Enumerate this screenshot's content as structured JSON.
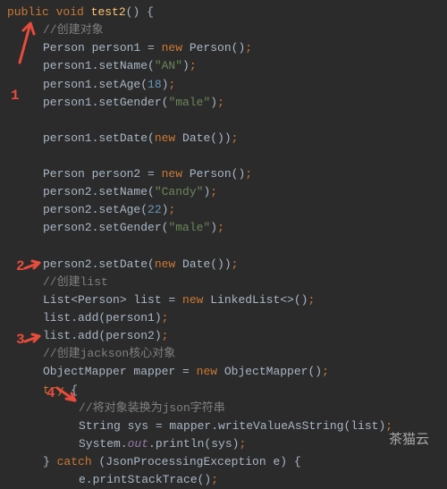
{
  "code": {
    "l1_kw1": "public",
    "l1_kw2": "void",
    "l1_method": "test2",
    "l1_rest": "() {",
    "l2_comment": "//创建对象",
    "l3_a": "Person person1 = ",
    "l3_kw": "new",
    "l3_b": " Person()",
    "l3_semi": ";",
    "l4_a": "person1.setName(",
    "l4_str": "\"AN\"",
    "l4_b": ")",
    "l4_semi": ";",
    "l5_a": "person1.setAge(",
    "l5_num": "18",
    "l5_b": ")",
    "l5_semi": ";",
    "l6_a": "person1.setGender(",
    "l6_str": "\"male\"",
    "l6_b": ")",
    "l6_semi": ";",
    "l7_a": "person1.setDate(",
    "l7_kw": "new",
    "l7_b": " Date())",
    "l7_semi": ";",
    "l8_a": "Person person2 = ",
    "l8_kw": "new",
    "l8_b": " Person()",
    "l8_semi": ";",
    "l9_a": "person2.setName(",
    "l9_str": "\"Candy\"",
    "l9_b": ")",
    "l9_semi": ";",
    "l10_a": "person2.setAge(",
    "l10_num": "22",
    "l10_b": ")",
    "l10_semi": ";",
    "l11_a": "person2.setGender(",
    "l11_str": "\"male\"",
    "l11_b": ")",
    "l11_semi": ";",
    "l12_a": "person2.setDate(",
    "l12_kw": "new",
    "l12_b": " Date())",
    "l12_semi": ";",
    "l13_comment": "//创建list",
    "l14_a": "List<Person> list = ",
    "l14_kw": "new",
    "l14_b": " LinkedList<>()",
    "l14_semi": ";",
    "l15_a": "list.add(person1)",
    "l15_semi": ";",
    "l16_a": "list.add(person2)",
    "l16_semi": ";",
    "l17_comment": "//创建jackson核心对象",
    "l18_a": "ObjectMapper mapper = ",
    "l18_kw": "new",
    "l18_b": " ObjectMapper()",
    "l18_semi": ";",
    "l19_kw": "try",
    "l19_b": " {",
    "l20_comment": "//将对象装换为json字符串",
    "l21_a": "String sys = mapper.writeValueAsString(list)",
    "l21_semi": ";",
    "l22_a": "System.",
    "l22_out": "out",
    "l22_b": ".println(sys)",
    "l22_semi": ";",
    "l23_a": "} ",
    "l23_kw": "catch",
    "l23_b": " (JsonProcessingException e) {",
    "l24_a": "e.printStackTrace()",
    "l24_semi": ";"
  },
  "annotations": {
    "n1": "1",
    "n2": "2",
    "n3": "3",
    "n4": "4"
  },
  "watermark": "茶猫云"
}
